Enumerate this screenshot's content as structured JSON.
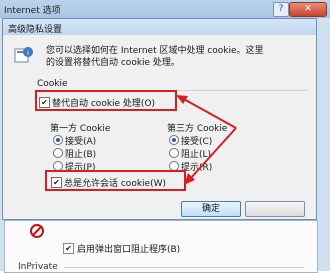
{
  "background_window": {
    "title": "Internet 选项",
    "help_label": "?",
    "close_label": "✕",
    "popup_blocker_label": "启用弹出窗口阻止程序(B)",
    "popup_blocker_checked": true,
    "inprivate_label": "InPrivate"
  },
  "dialog": {
    "title": "高级隐私设置",
    "description_line1": "您可以选择如何在 Internet 区域中处理 cookie。这里",
    "description_line2": "的设置将替代自动 cookie 处理。",
    "group_label": "Cookie",
    "override_automatic": {
      "label": "替代自动 cookie 处理(O)",
      "checked": true
    },
    "first_party": {
      "header": "第一方 Cookie",
      "options": [
        {
          "label": "接受(A)",
          "selected": true
        },
        {
          "label": "阻止(B)",
          "selected": false
        },
        {
          "label": "提示(P)",
          "selected": false
        }
      ]
    },
    "third_party": {
      "header": "第三方 Cookie",
      "options": [
        {
          "label": "接受(C)",
          "selected": true
        },
        {
          "label": "阻止(L)",
          "selected": false
        },
        {
          "label": "提示(R)",
          "selected": false
        }
      ]
    },
    "always_allow_session": {
      "label": "总是允许会话 cookie(W)",
      "checked": true
    },
    "ok_label": "确定",
    "cancel_label": ""
  },
  "colors": {
    "annotation_red": "#d42020"
  }
}
